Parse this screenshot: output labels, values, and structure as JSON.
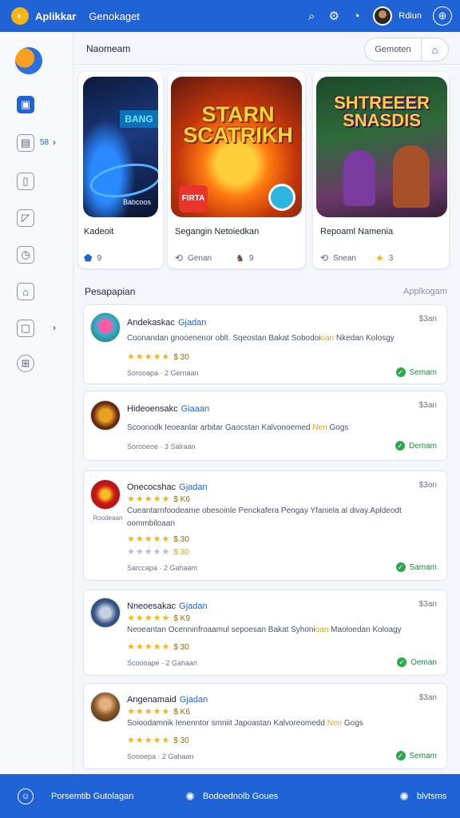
{
  "topbar": {
    "app_title": "Aplikkar",
    "tab": "Genokaget",
    "user_name": "Rdiun",
    "icons": [
      "search-icon",
      "filter-icon",
      "notification-icon",
      "globe-icon"
    ]
  },
  "sidebar": {
    "badge": "58",
    "icons": [
      "app-logo",
      "home-icon",
      "calendar-icon",
      "clipboard-icon",
      "chart-icon",
      "gauge-icon",
      "inbox-icon",
      "folder-icon",
      "grid-icon"
    ]
  },
  "main": {
    "title": "Naomeam",
    "filter_label": "Gemoten"
  },
  "featured": [
    {
      "name": "Kadeoit",
      "tag": "Babcoos",
      "meta": "9"
    },
    {
      "name": "Segangin Netoiedkan",
      "title": "STARN SCATRIKH",
      "badge": "FIRTA",
      "meta_left": "Genan",
      "meta_right": "9"
    },
    {
      "name": "Repoaml Namenia",
      "title": "SHTREEER SNASDIS",
      "meta_left": "Snean",
      "meta_right": "3"
    }
  ],
  "section": {
    "title": "Pesapapian",
    "link": "Applkogam"
  },
  "apps": [
    {
      "name": "Andekaskac",
      "tag": "Gjadan",
      "price": "$3an",
      "desc_pre": "Coonandan gnooenenor oblt. Sqeostan Bakat Sobodoi",
      "desc_hl": "oan",
      "desc_post": " Nkedan Kolosgy",
      "rating": "★★★★★",
      "rating_value": "$ 30",
      "meta": "Sorooapa · 2 Gernaan",
      "status": "Semam"
    },
    {
      "name": "Hideoensakc",
      "tag": "Giaaan",
      "price": "$3an",
      "desc_pre": "Scoonodk Ieoeanlar arbitar Gaocstan Kalvonoemed",
      "desc_hl": "Nen",
      "desc_post": " Gogs",
      "meta": "Sorooeoe · 3 Salraan",
      "status": "Demam"
    },
    {
      "name": "Onecocshac",
      "tag": "Gjadan",
      "price": "$3on",
      "sub": "Roodeaan",
      "rating_top": "★★★★★",
      "rating_top_value": "$ K6",
      "desc_pre": "Cueantarnfoodeame obesoinle Penckafera Pengay Yfaniela al divay.Apldeodt oommbiloaan",
      "desc_hl": "",
      "desc_post": "",
      "rating": "★★★★★",
      "rating_value": "$.30",
      "rating2": "★★★★★",
      "rating2_value": "$.30",
      "meta": "Sarccapa · 2 Gahaam",
      "status": "Samam"
    },
    {
      "name": "Nneoesakac",
      "tag": "Gjadan",
      "price": "$3an",
      "rating_top": "★★★★★",
      "rating_top_value": "$ K9",
      "desc_pre": "Neoeantan Ocenninfroaamul sepoesan Bakat Syhoni",
      "desc_hl": "oan",
      "desc_post": " Maoloedan Koloagy",
      "rating": "★★★★★",
      "rating_value": "$ 30",
      "meta": "Scoooape · 2 Gahaan",
      "status": "Oeman"
    },
    {
      "name": "Angenamaid",
      "tag": "Gjadan",
      "price": "$3an",
      "rating_top": "★★★★★",
      "rating_top_value": "$ K6",
      "desc_pre": "Soioodamnik Ienenntor smniit Japoastan Kalvoreomedd",
      "desc_hl": "Nen",
      "desc_post": " Gogs",
      "rating": "★★★★★",
      "rating_value": "$ 30",
      "meta": "Soooepa · 2 Gahaan",
      "status": "Semam"
    }
  ],
  "bottombar": {
    "left": "Porsemtib Gutolagan",
    "center": "Bodoednolb Goues",
    "right": "blvtsms"
  },
  "colors": {
    "primary": "#1f63d6",
    "star": "#f4b414",
    "success": "#2aa84a"
  }
}
